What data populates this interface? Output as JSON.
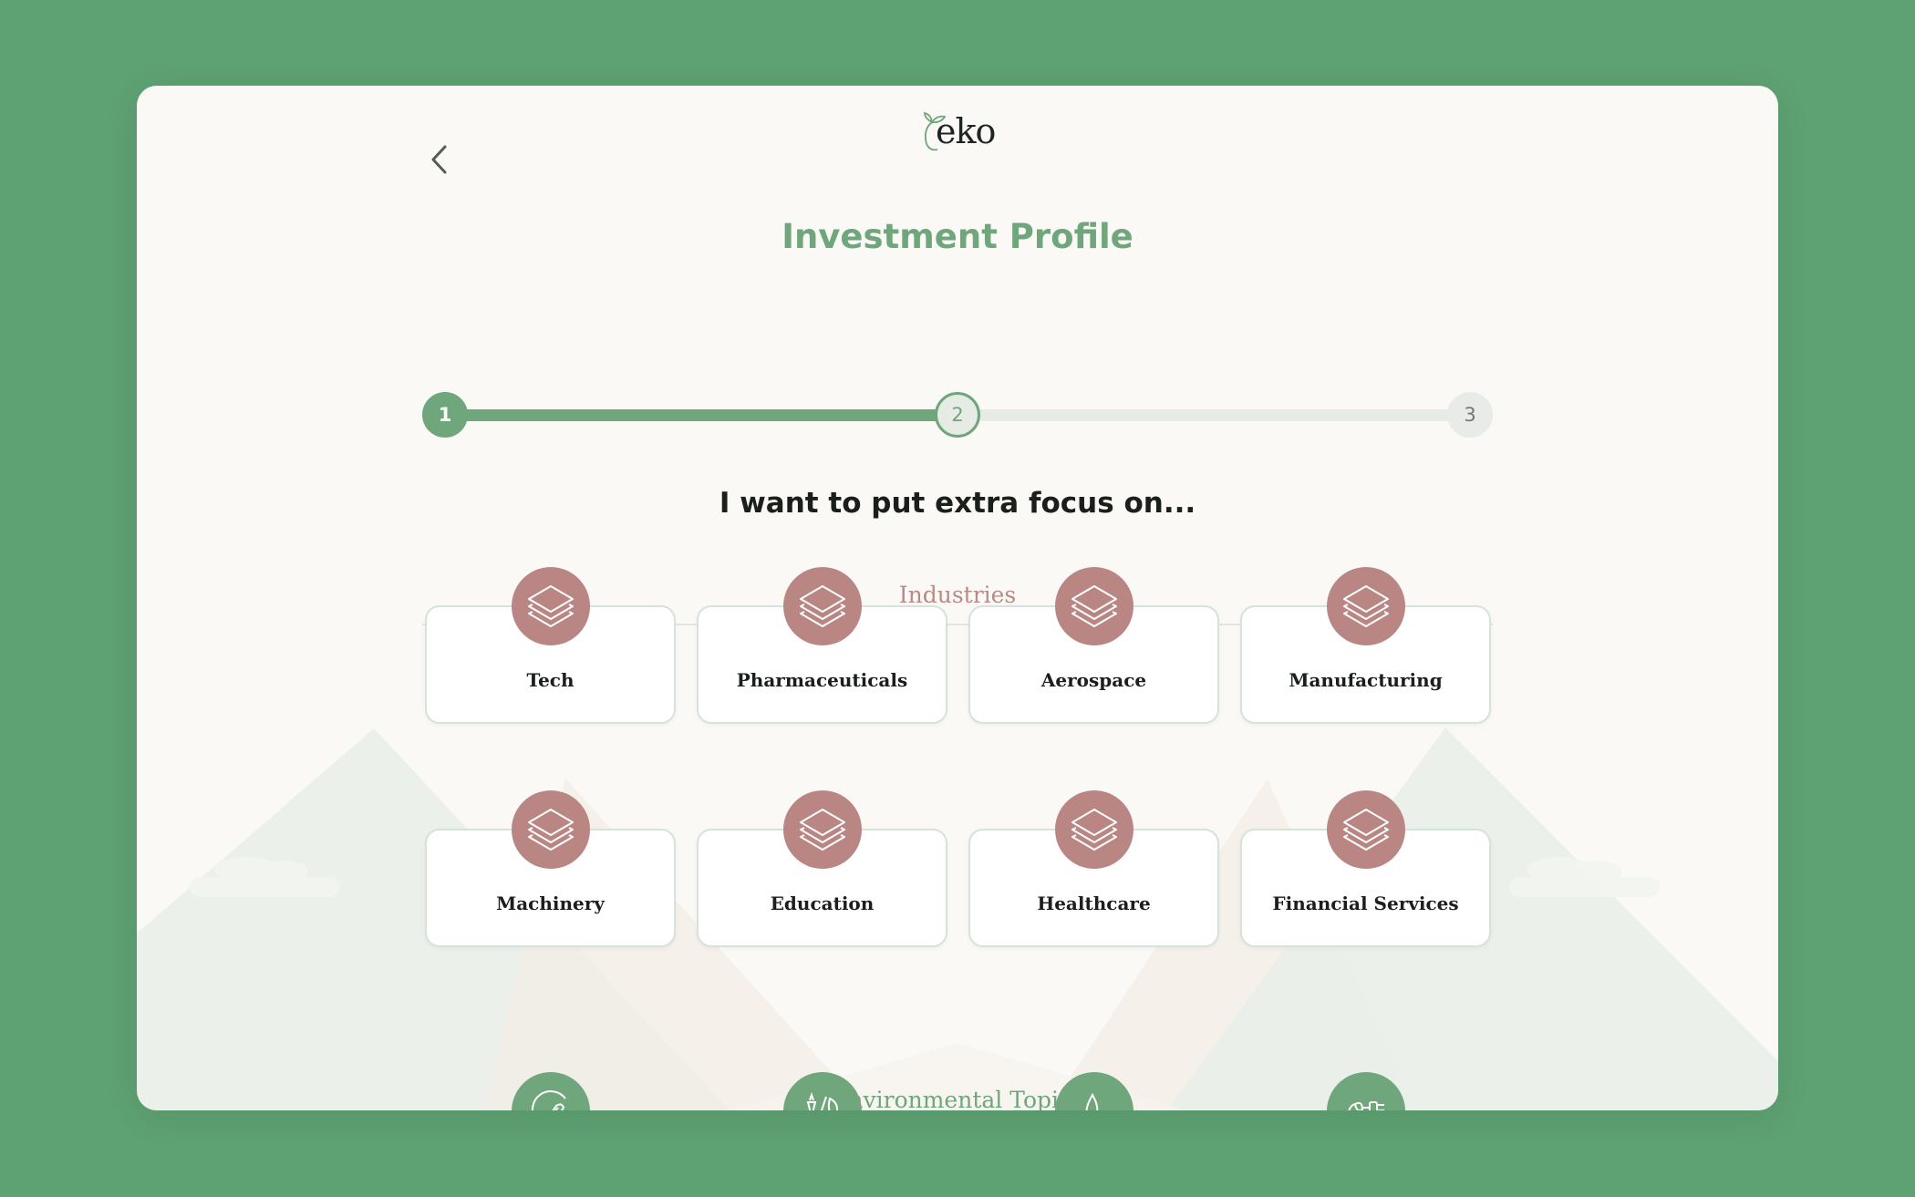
{
  "app": {
    "logo_text": "eko",
    "back_icon": "chevron-left-icon",
    "logo_icon": "leaf-sprout-icon"
  },
  "header": {
    "title": "Investment Profile"
  },
  "stepper": {
    "steps": [
      {
        "label": "1",
        "state": "done"
      },
      {
        "label": "2",
        "state": "current"
      },
      {
        "label": "3",
        "state": "todo"
      }
    ],
    "progress_percent": 50
  },
  "question": "I want to put extra focus on...",
  "sections": {
    "industries": {
      "heading": "Industries",
      "items": [
        {
          "label": "Tech",
          "icon": "layers-icon"
        },
        {
          "label": "Pharmaceuticals",
          "icon": "layers-icon"
        },
        {
          "label": "Aerospace",
          "icon": "layers-icon"
        },
        {
          "label": "Manufacturing",
          "icon": "layers-icon"
        },
        {
          "label": "Machinery",
          "icon": "layers-icon"
        },
        {
          "label": "Education",
          "icon": "layers-icon"
        },
        {
          "label": "Healthcare",
          "icon": "layers-icon"
        },
        {
          "label": "Financial Services",
          "icon": "layers-icon"
        }
      ]
    },
    "environmental": {
      "heading": "Environmental Topics",
      "items": [
        {
          "icon": "recycle-leaf-icon"
        },
        {
          "icon": "food-agriculture-icon"
        },
        {
          "icon": "water-drop-icon"
        },
        {
          "icon": "green-energy-plug-icon"
        }
      ]
    }
  },
  "colors": {
    "brand_green": "#6fa67b",
    "outer_background": "#5ea172",
    "rose_accent": "#b98684",
    "panel_background": "#faf9f6",
    "track_gray": "#e6ebe5"
  }
}
